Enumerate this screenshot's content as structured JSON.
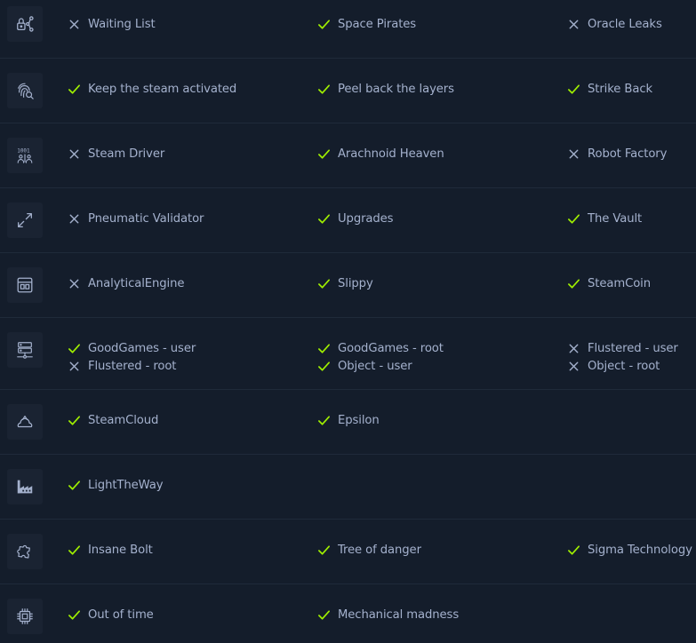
{
  "colors": {
    "background": "#141d2b",
    "icon_box": "#1a2332",
    "divider": "#1f2a3a",
    "text": "#a4b1cd",
    "check": "#9fef00",
    "cross": "#a4b1cd"
  },
  "rows": [
    {
      "icon": "lock-share-icon",
      "lines": [
        [
          {
            "label": "Waiting List",
            "status": "cross"
          },
          {
            "label": "Space Pirates",
            "status": "check"
          },
          {
            "label": "Oracle Leaks",
            "status": "cross"
          }
        ]
      ]
    },
    {
      "icon": "fingerprint-search-icon",
      "lines": [
        [
          {
            "label": "Keep the steam activated",
            "status": "check"
          },
          {
            "label": "Peel back the layers",
            "status": "check"
          },
          {
            "label": "Strike Back",
            "status": "check"
          }
        ]
      ]
    },
    {
      "icon": "binary-users-icon",
      "lines": [
        [
          {
            "label": "Steam Driver",
            "status": "cross"
          },
          {
            "label": "Arachnoid Heaven",
            "status": "check"
          },
          {
            "label": "Robot Factory",
            "status": "cross"
          }
        ]
      ]
    },
    {
      "icon": "expand-arrows-icon",
      "lines": [
        [
          {
            "label": "Pneumatic Validator",
            "status": "cross"
          },
          {
            "label": "Upgrades",
            "status": "check"
          },
          {
            "label": "The Vault",
            "status": "check"
          }
        ]
      ]
    },
    {
      "icon": "browser-window-icon",
      "lines": [
        [
          {
            "label": "AnalyticalEngine",
            "status": "cross"
          },
          {
            "label": "Slippy",
            "status": "check"
          },
          {
            "label": "SteamCoin",
            "status": "check"
          }
        ]
      ]
    },
    {
      "icon": "server-network-icon",
      "lines": [
        [
          {
            "label": "GoodGames - user",
            "status": "check"
          },
          {
            "label": "GoodGames - root",
            "status": "check"
          },
          {
            "label": "Flustered - user",
            "status": "cross"
          }
        ],
        [
          {
            "label": "Flustered - root",
            "status": "cross"
          },
          {
            "label": "Object - user",
            "status": "check"
          },
          {
            "label": "Object - root",
            "status": "cross"
          }
        ]
      ]
    },
    {
      "icon": "cloud-hat-icon",
      "lines": [
        [
          {
            "label": "SteamCloud",
            "status": "check"
          },
          {
            "label": "Epsilon",
            "status": "check"
          }
        ]
      ]
    },
    {
      "icon": "factory-icon",
      "lines": [
        [
          {
            "label": "LightTheWay",
            "status": "check"
          }
        ]
      ]
    },
    {
      "icon": "puzzle-piece-icon",
      "lines": [
        [
          {
            "label": "Insane Bolt",
            "status": "check"
          },
          {
            "label": "Tree of danger",
            "status": "check"
          },
          {
            "label": "Sigma Technology",
            "status": "check"
          }
        ]
      ]
    },
    {
      "icon": "cpu-chip-icon",
      "lines": [
        [
          {
            "label": "Out of time",
            "status": "check"
          },
          {
            "label": "Mechanical madness",
            "status": "check"
          }
        ]
      ]
    }
  ]
}
